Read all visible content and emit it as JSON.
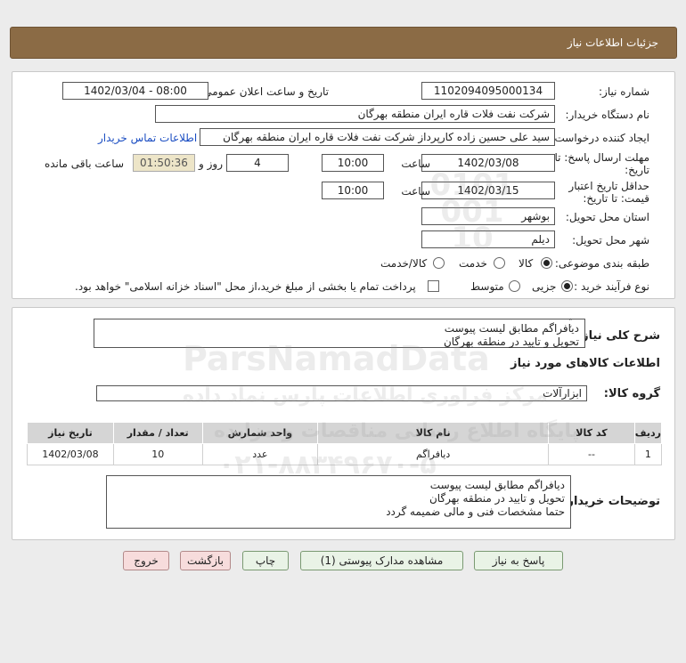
{
  "header": {
    "title": "جزئیات اطلاعات نیاز"
  },
  "form": {
    "need_number_label": "شماره نیاز:",
    "need_number": "1102094095000134",
    "announce_label": "تاریخ و ساعت اعلان عمومی:",
    "announce_value": "1402/03/04 - 08:00",
    "buyer_org_label": "نام دستگاه خریدار:",
    "buyer_org": "شرکت نفت فلات قاره ایران منطقه بهرگان",
    "creator_label": "ایجاد کننده درخواست:",
    "creator": "سید علی حسین زاده کارپرداز شرکت نفت فلات قاره ایران منطقه بهرگان",
    "contact_link": "اطلاعات تماس خریدار",
    "deadline_label_1": "مهلت ارسال پاسخ: تا",
    "deadline_label_2": "تاریخ:",
    "deadline_date": "1402/03/08",
    "time_label": "ساعت",
    "deadline_time": "10:00",
    "days": "4",
    "days_label": "روز و",
    "remaining_time": "01:50:36",
    "remaining_label": "ساعت باقی مانده",
    "validity_label_1": "حداقل تاریخ اعتبار",
    "validity_label_2": "قیمت: تا تاریخ:",
    "validity_date": "1402/03/15",
    "validity_time": "10:00",
    "province_label": "استان محل تحویل:",
    "province": "بوشهر",
    "city_label": "شهر محل تحویل:",
    "city": "دیلم",
    "category_label": "طبقه بندی موضوعی:",
    "category_options": [
      "کالا",
      "خدمت",
      "کالا/خدمت"
    ],
    "category_selected": "کالا",
    "process_label": "نوع فرآیند خرید :",
    "process_options": [
      "جزیی",
      "متوسط"
    ],
    "process_selected": "جزیی",
    "payment_note": "پرداخت تمام یا بخشی از مبلغ خرید،از محل \"اسناد خزانه اسلامی\" خواهد بود."
  },
  "details": {
    "summary_label": "شرح کلی نیاز:",
    "summary_lines": [
      "دیافراگم مطابق لیست پیوست",
      "تحویل و تایید در منطقه بهرگان"
    ],
    "goods_info_title": "اطلاعات کالاهای مورد نیاز",
    "group_label": "گروه کالا:",
    "group_value": "ابزارآلات",
    "table": {
      "headers": [
        "ردیف",
        "کد کالا",
        "نام کالا",
        "واحد شمارش",
        "تعداد / مقدار",
        "تاریخ نیاز"
      ],
      "rows": [
        [
          "1",
          "--",
          "دیافراگم",
          "عدد",
          "10",
          "1402/03/08"
        ]
      ]
    },
    "buyer_notes_label": "توضیحات خریدار:",
    "buyer_notes_lines": [
      "دیافراگم مطابق لیست پیوست",
      "تحویل و تایید در منطقه بهرگان",
      "حتما مشخصات فنی و مالی ضمیمه گردد"
    ]
  },
  "buttons": {
    "reply": "پاسخ به نیاز",
    "view_docs": "مشاهده مدارک پیوستی (1)",
    "print": "چاپ",
    "back": "بازگشت",
    "exit": "خروج"
  },
  "watermark": {
    "brand": "ParsNamadData",
    "line1": "مرکز فراوری اطلاعات پارس نماد داده",
    "line2": "پایگاه اطلاع رسانی مناقصات و مزایده",
    "phone": "۰۲۱-۸۸۳۴۹۶۷۰-۵",
    "number": "0101 001 10"
  }
}
